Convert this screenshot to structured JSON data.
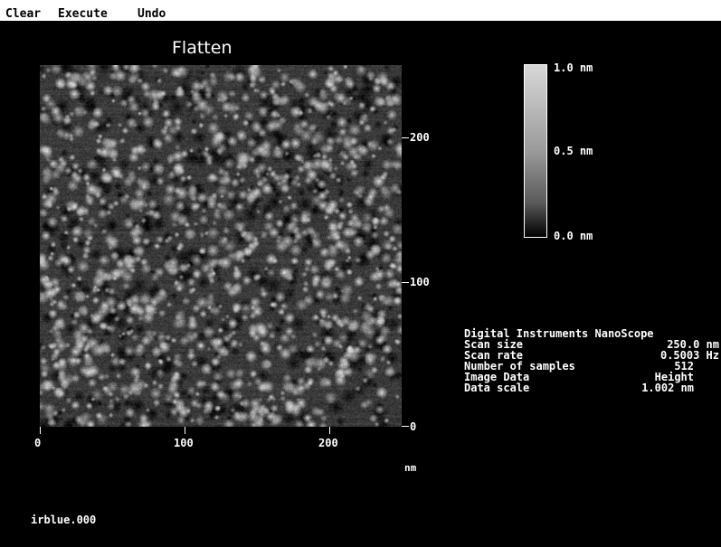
{
  "menu": {
    "items": [
      "Clear",
      "Execute",
      "Undo"
    ]
  },
  "panel": {
    "title": "Flatten",
    "filename": "irblue.000",
    "x_axis": {
      "ticks": [
        "0",
        "100",
        "200"
      ],
      "unit": "nm"
    },
    "y_axis": {
      "ticks": [
        "200",
        "100",
        "0"
      ]
    },
    "colorbar": {
      "max_label": "1.0 nm",
      "mid_label": "0.5 nm",
      "min_label": "0.0 nm"
    },
    "info": {
      "header": "Digital Instruments NanoScope",
      "rows": [
        {
          "key": "Scan size",
          "value": "250.0 nm"
        },
        {
          "key": "Scan rate",
          "value": "0.5003 Hz"
        },
        {
          "key": "Number of samples",
          "value": "512"
        },
        {
          "key": "Image Data",
          "value": "Height"
        },
        {
          "key": "Data scale",
          "value": "1.002 nm"
        }
      ]
    }
  },
  "colors": {
    "menubar_bg": "#ffffff",
    "screen_bg": "#000000",
    "text": "#ffffff"
  }
}
